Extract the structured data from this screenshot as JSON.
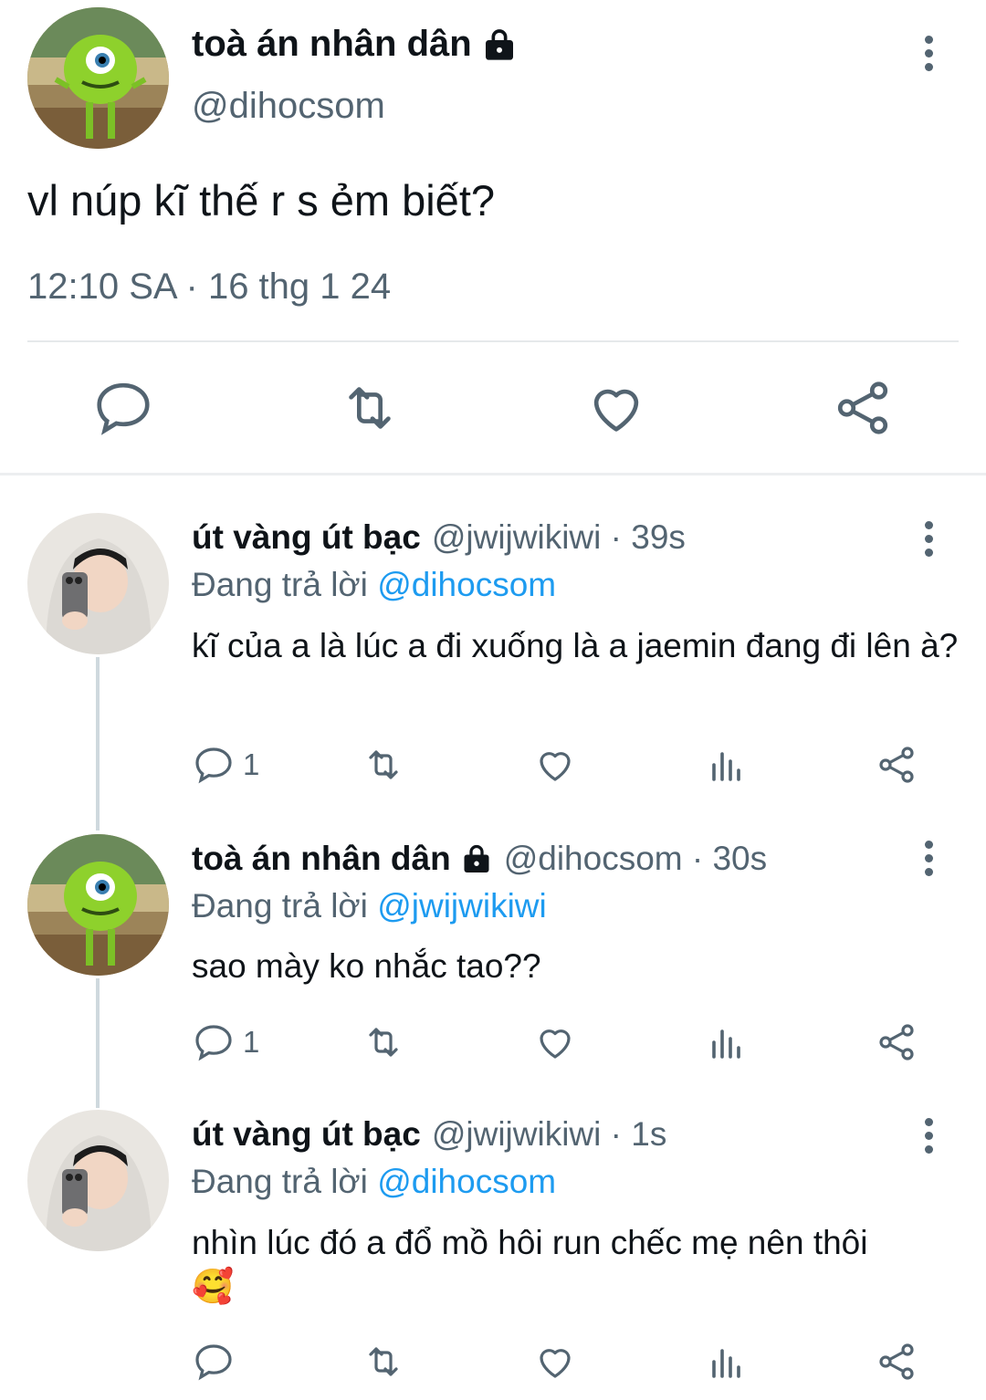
{
  "main_tweet": {
    "author_name": "toà án nhân dân",
    "handle": "@dihocsom",
    "text": "vl núp kĩ thế r s ẻm biết?",
    "time": "12:10 SA",
    "separator": "·",
    "date": "16 thg 1 24",
    "avatar_icon": "mike-wazowski-avatar",
    "lock_icon": "lock-icon"
  },
  "replies": [
    {
      "author_name": "út vàng út bạc",
      "handle": "@jwijwikiwi · 39s",
      "replying_prefix": "Đang trả lời",
      "replying_to": "@dihocsom",
      "text": "kĩ của a là lúc a đi xuống là a jaemin đang đi lên à?",
      "reply_count": "1"
    },
    {
      "author_name": "toà án nhân dân",
      "handle": "@dihocsom · 30s",
      "replying_prefix": "Đang trả lời",
      "replying_to": "@jwijwikiwi",
      "text": "sao mày ko nhắc tao??",
      "reply_count": "1"
    },
    {
      "author_name": "út vàng út bạc",
      "handle": "@jwijwikiwi · 1s",
      "replying_prefix": "Đang trả lời",
      "replying_to": "@dihocsom",
      "text": "nhìn lúc đó a đổ mồ hôi run chếc mẹ nên thôi🥰",
      "reply_count": ""
    }
  ],
  "colors": {
    "accent": "#1d9bf0",
    "secondary_text": "#536471",
    "primary_text": "#0f1419",
    "divider": "#e6e9eb"
  }
}
